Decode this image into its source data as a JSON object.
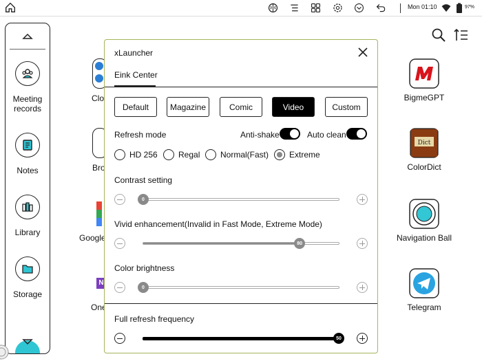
{
  "status": {
    "time": "Mon 01:10",
    "battery": "97%"
  },
  "dock": {
    "items": [
      {
        "label": "Meeting records"
      },
      {
        "label": "Notes"
      },
      {
        "label": "Library"
      },
      {
        "label": "Storage"
      }
    ]
  },
  "apps": {
    "right": [
      {
        "label": "BigmeGPT"
      },
      {
        "label": "ColorDict"
      },
      {
        "label": "Navigation Ball"
      },
      {
        "label": "Telegram"
      }
    ],
    "partial": [
      "Clo",
      "Bro",
      "Google",
      "One"
    ]
  },
  "dialog": {
    "title": "xLauncher",
    "tab": "Eink Center",
    "presets": [
      "Default",
      "Magazine",
      "Comic",
      "Video",
      "Custom"
    ],
    "active_preset": "Video",
    "refresh_mode": {
      "label": "Refresh mode",
      "anti_shake": {
        "label": "Anti-shake",
        "on": true
      },
      "auto_clean": {
        "label": "Auto clean",
        "on": true
      },
      "options": [
        "HD 256",
        "Regal",
        "Normal(Fast)",
        "Extreme"
      ],
      "selected": "Extreme"
    },
    "contrast": {
      "label": "Contrast setting",
      "value": 0,
      "max": 100
    },
    "vivid": {
      "label": "Vivid enhancement(Invalid in Fast Mode, Extreme Mode)",
      "value": 80,
      "max": 100
    },
    "brightness": {
      "label": "Color brightness",
      "value": 0,
      "max": 100
    },
    "full_refresh": {
      "label": "Full refresh frequency",
      "value": 50,
      "max": 50
    }
  },
  "colors": {
    "dialog_border": "#a4b45a",
    "bigme_red": "#d9141c",
    "colordict_brown": "#8a3b12",
    "navigation_cyan": "#33c6d4",
    "telegram_blue": "#2aa3e0",
    "storage_cyan": "#2fc5d3"
  }
}
